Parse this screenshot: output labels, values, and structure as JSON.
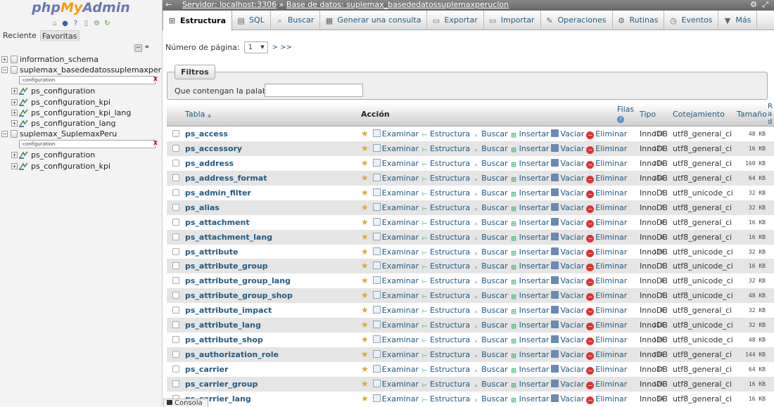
{
  "nav": {
    "logo_php": "php",
    "logo_my": "My",
    "logo_admin": "Admin",
    "tabs": [
      "Reciente",
      "Favoritas"
    ],
    "tree": [
      {
        "type": "db",
        "label": "information_schema",
        "level": 0,
        "expander": "+"
      },
      {
        "type": "db",
        "label": "suplemax_basededatossuplemaxperuclon",
        "level": 0,
        "expander": "−"
      },
      {
        "type": "filter",
        "value": "configuration",
        "clear": "X"
      },
      {
        "type": "table",
        "label": "ps_configuration",
        "level": 1,
        "expander": "+"
      },
      {
        "type": "table",
        "label": "ps_configuration_kpi",
        "level": 1,
        "expander": "+"
      },
      {
        "type": "table",
        "label": "ps_configuration_kpi_lang",
        "level": 1,
        "expander": "+"
      },
      {
        "type": "table",
        "label": "ps_configuration_lang",
        "level": 1,
        "expander": "+"
      },
      {
        "type": "db",
        "label": "suplemax_SuplemaxPeru",
        "level": 0,
        "expander": "−"
      },
      {
        "type": "filter",
        "value": "configuration",
        "clear": "X"
      },
      {
        "type": "table",
        "label": "ps_configuration",
        "level": 1,
        "expander": "+"
      },
      {
        "type": "table",
        "label": "ps_configuration_kpi",
        "level": 1,
        "expander": "+"
      }
    ]
  },
  "topbar": {
    "server": "Servidor: localhost:3306",
    "sep": "»",
    "database": "Base de datos: suplemax_basededatossuplemaxperuclon"
  },
  "tabs": [
    {
      "label": "Estructura",
      "icon": "structure-icon",
      "glyph": "⊞",
      "active": true
    },
    {
      "label": "SQL",
      "icon": "sql-icon",
      "glyph": "▤",
      "active": false
    },
    {
      "label": "Buscar",
      "icon": "search-icon",
      "glyph": "⌕",
      "active": false
    },
    {
      "label": "Generar una consulta",
      "icon": "query-icon",
      "glyph": "▦",
      "active": false
    },
    {
      "label": "Exportar",
      "icon": "export-icon",
      "glyph": "▭",
      "active": false
    },
    {
      "label": "Importar",
      "icon": "import-icon",
      "glyph": "▭",
      "active": false
    },
    {
      "label": "Operaciones",
      "icon": "wrench-icon",
      "glyph": "✎",
      "active": false
    },
    {
      "label": "Rutinas",
      "icon": "routines-icon",
      "glyph": "⚙",
      "active": false
    },
    {
      "label": "Eventos",
      "icon": "clock-icon",
      "glyph": "◷",
      "active": false
    },
    {
      "label": "Más",
      "icon": "chevron-down-icon",
      "glyph": "▼",
      "active": false
    }
  ],
  "pager": {
    "label": "Número de página:",
    "value": "1",
    "next": "> >>"
  },
  "filters": {
    "legend": "Filtros",
    "label": "Que contengan la palabra:",
    "value": ""
  },
  "table": {
    "headers": {
      "tabla": "Tabla",
      "sort": "▲",
      "accion": "Acción",
      "filas": "Filas",
      "tipo": "Tipo",
      "cotejamiento": "Cotejamiento",
      "tamano": "Tamaño",
      "extra": "R a d"
    },
    "actions": [
      "Examinar",
      "Estructura",
      "Buscar",
      "Insertar",
      "Vaciar",
      "Eliminar"
    ],
    "rows": [
      {
        "name": "ps_access",
        "rows": "728",
        "type": "InnoDB",
        "collation": "utf8_general_ci",
        "size": "48 KB"
      },
      {
        "name": "ps_accessory",
        "rows": "173",
        "type": "InnoDB",
        "collation": "utf8_general_ci",
        "size": "16 KB"
      },
      {
        "name": "ps_address",
        "rows": "226",
        "type": "InnoDB",
        "collation": "utf8_general_ci",
        "size": "160 KB"
      },
      {
        "name": "ps_address_format",
        "rows": "244",
        "type": "InnoDB",
        "collation": "utf8_general_ci",
        "size": "64 KB"
      },
      {
        "name": "ps_admin_filter",
        "rows": "2",
        "type": "InnoDB",
        "collation": "utf8_unicode_ci",
        "size": "32 KB"
      },
      {
        "name": "ps_alias",
        "rows": "2",
        "type": "InnoDB",
        "collation": "utf8_general_ci",
        "size": "32 KB"
      },
      {
        "name": "ps_attachment",
        "rows": "0",
        "type": "InnoDB",
        "collation": "utf8_general_ci",
        "size": "16 KB"
      },
      {
        "name": "ps_attachment_lang",
        "rows": "0",
        "type": "InnoDB",
        "collation": "utf8_general_ci",
        "size": "16 KB"
      },
      {
        "name": "ps_attribute",
        "rows": "109",
        "type": "InnoDB",
        "collation": "utf8_unicode_ci",
        "size": "32 KB"
      },
      {
        "name": "ps_attribute_group",
        "rows": "2",
        "type": "InnoDB",
        "collation": "utf8_unicode_ci",
        "size": "16 KB"
      },
      {
        "name": "ps_attribute_group_lang",
        "rows": "4",
        "type": "InnoDB",
        "collation": "utf8_unicode_ci",
        "size": "32 KB"
      },
      {
        "name": "ps_attribute_group_shop",
        "rows": "2",
        "type": "InnoDB",
        "collation": "utf8_unicode_ci",
        "size": "48 KB"
      },
      {
        "name": "ps_attribute_impact",
        "rows": "0",
        "type": "InnoDB",
        "collation": "utf8_general_ci",
        "size": "32 KB"
      },
      {
        "name": "ps_attribute_lang",
        "rows": "218",
        "type": "InnoDB",
        "collation": "utf8_unicode_ci",
        "size": "32 KB"
      },
      {
        "name": "ps_attribute_shop",
        "rows": "109",
        "type": "InnoDB",
        "collation": "utf8_unicode_ci",
        "size": "48 KB"
      },
      {
        "name": "ps_authorization_role",
        "rows": "736",
        "type": "InnoDB",
        "collation": "utf8_general_ci",
        "size": "144 KB"
      },
      {
        "name": "ps_carrier",
        "rows": "42",
        "type": "InnoDB",
        "collation": "utf8_general_ci",
        "size": "64 KB"
      },
      {
        "name": "ps_carrier_group",
        "rows": "126",
        "type": "InnoDB",
        "collation": "utf8_general_ci",
        "size": "16 KB"
      },
      {
        "name": "ps_carrier_lang",
        "rows": "84",
        "type": "InnoDB",
        "collation": "utf8_general_ci",
        "size": "16 KB"
      }
    ]
  },
  "console": {
    "label": "Consola"
  }
}
